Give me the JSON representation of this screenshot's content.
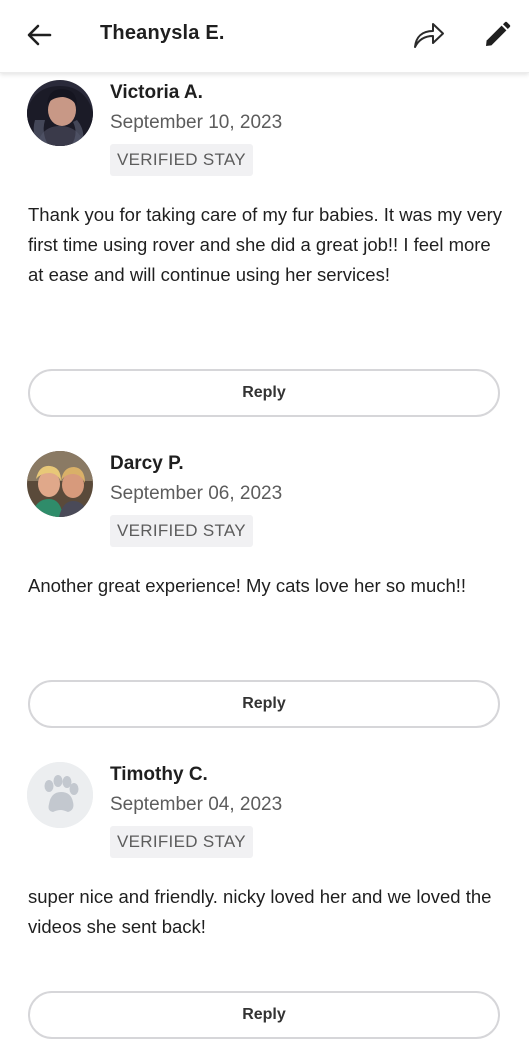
{
  "header": {
    "title": "Theanysla E.",
    "back_icon": "arrow-left-icon",
    "share_icon": "share-icon",
    "edit_icon": "pencil-icon"
  },
  "reviews": [
    {
      "name": "Victoria A.",
      "date": "September 10, 2023",
      "badge": "VERIFIED STAY",
      "text": "Thank you for taking care of my fur babies. It was my very first time using rover and she did a great job!! I feel more at ease and will continue using her services!",
      "reply_label": "Reply",
      "avatar": "photo"
    },
    {
      "name": "Darcy P.",
      "date": "September 06, 2023",
      "badge": "VERIFIED STAY",
      "text": "Another great experience! My cats love her so much!!",
      "reply_label": "Reply",
      "avatar": "photo"
    },
    {
      "name": "Timothy C.",
      "date": "September 04, 2023",
      "badge": "VERIFIED STAY",
      "text": "super nice and friendly. nicky loved her and we loved the videos she sent back!",
      "reply_label": "Reply",
      "avatar": "paw-placeholder-icon"
    }
  ],
  "colors": {
    "badge_bg": "#f1f1f3",
    "button_border": "#d6d6d9",
    "muted_text": "#5c5c5c"
  }
}
